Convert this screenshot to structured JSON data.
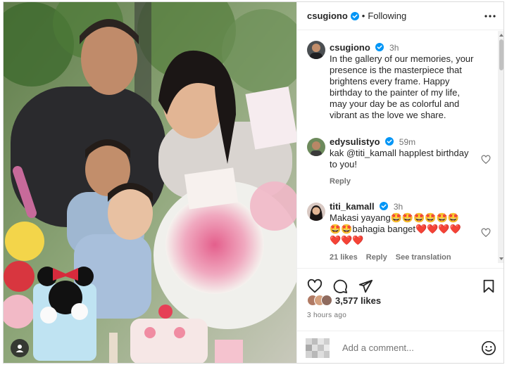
{
  "header": {
    "username": "csugiono",
    "separator": "•",
    "follow_status": "Following"
  },
  "caption": {
    "username": "csugiono",
    "time": "3h",
    "text": "In the gallery of our memories, your presence is the masterpiece that brightens every frame. Happy birthday to the painter of my life, may your day be as colorful and vibrant as the love we share."
  },
  "comments": [
    {
      "username": "edysulistyo",
      "time": "59m",
      "mention": "@titi_kamall",
      "pre": "kak ",
      "post": " happlest birthday to you!",
      "reply_label": "Reply"
    },
    {
      "username": "titi_kamall",
      "time": "3h",
      "line1": "Makasi yayang🤩🤩🤩🤩🤩🤩",
      "line2": "🤩🤩bahagia banget❤️❤️❤️❤️",
      "line3": "❤️❤️❤️",
      "likes_label": "21 likes",
      "reply_label": "Reply",
      "translate_label": "See translation"
    }
  ],
  "likes": {
    "count": "3,577 likes"
  },
  "timestamp": "3 hours ago",
  "comment_box": {
    "placeholder": "Add a comment..."
  },
  "icons": {
    "verified": "verified-badge-icon",
    "more": "more-options-icon",
    "like": "heart-icon",
    "comment": "comment-icon",
    "share": "share-icon",
    "save": "bookmark-icon",
    "emoji": "emoji-icon",
    "tagged": "tagged-user-icon"
  },
  "colors": {
    "verified_blue": "#0095f6",
    "text": "#262626",
    "muted": "#737373",
    "heart_red": "#e0245e"
  }
}
